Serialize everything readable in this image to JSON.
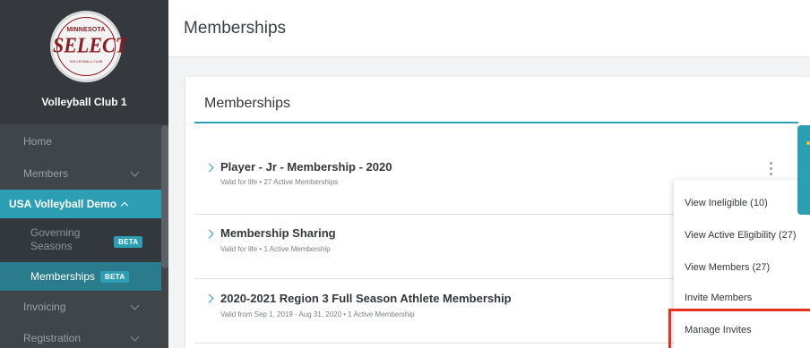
{
  "sidebar": {
    "logo": {
      "top_text": "MINNESOTA",
      "main_text": "SELECT",
      "bottom_text": "VOLLEYBALL CLUB"
    },
    "club_name": "Volleyball Club 1",
    "items": {
      "home": "Home",
      "members": "Members",
      "usa_volleyball": "USA Volleyball Demo",
      "governing_seasons": "Governing Seasons",
      "governing_badge": "BETA",
      "memberships": "Memberships",
      "memberships_badge": "BETA",
      "invoicing": "Invoicing",
      "registration": "Registration"
    }
  },
  "header": {
    "title": "Memberships"
  },
  "card": {
    "title": "Memberships",
    "rows": [
      {
        "title": "Player - Jr - Membership - 2020",
        "subtitle": "Valid for life • 27 Active Memberships"
      },
      {
        "title": "Membership Sharing",
        "subtitle": "Valid for life • 1 Active Membership"
      },
      {
        "title": "2020-2021 Region 3 Full Season Athlete Membership",
        "subtitle": "Valid from Sep 1, 2019 - Aug 31, 2020 • 1 Active Membership"
      }
    ]
  },
  "menu": {
    "items": [
      "View Ineligible (10)",
      "View Active Eligibility (27)",
      "View Members (27)",
      "Invite Members",
      "Manage Invites"
    ],
    "highlighted": "Manage Invites"
  },
  "colors": {
    "sidebar_bg": "#3f4549",
    "accent": "#2d9fb5",
    "active_item": "#2a7c8d",
    "highlight_border": "#e8321e",
    "logo_red": "#8d1b20"
  },
  "icons": {
    "row_expand": "chevron-right-icon",
    "nav_expand": "chevron-down-icon",
    "nav_collapse": "chevron-up-icon",
    "actions": "kebab-menu-icon"
  }
}
